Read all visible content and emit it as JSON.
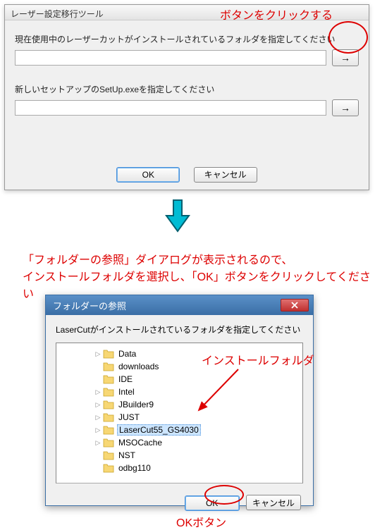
{
  "dialog1": {
    "title": "レーザー設定移行ツール",
    "label1": "現在使用中のレーザーカットがインストールされているフォルダを指定してください",
    "label2": "新しいセットアップのSetUp.exeを指定してください",
    "browse_arrow": "→",
    "ok_label": "OK",
    "cancel_label": "キャンセル"
  },
  "annotation1": "ボタンをクリックする",
  "instruction_line1": "「フォルダーの参照」ダイアログが表示されるので、",
  "instruction_line2": "インストールフォルダを選択し、「OK」ボタンをクリックしてください",
  "dialog2": {
    "title": "フォルダーの参照",
    "label": "LaserCutがインストールされているフォルダを指定してください",
    "ok_label": "OK",
    "cancel_label": "キャンセル",
    "tree": [
      {
        "name": "Data",
        "expand": true
      },
      {
        "name": "downloads",
        "expand": false
      },
      {
        "name": "IDE",
        "expand": false
      },
      {
        "name": "Intel",
        "expand": true
      },
      {
        "name": "JBuilder9",
        "expand": true
      },
      {
        "name": "JUST",
        "expand": true
      },
      {
        "name": "LaserCut55_GS4030",
        "expand": true,
        "selected": true
      },
      {
        "name": "MSOCache",
        "expand": true
      },
      {
        "name": "NST",
        "expand": false
      },
      {
        "name": "odbg110",
        "expand": false
      }
    ]
  },
  "install_folder_anno": "インストールフォルダ",
  "ok_button_anno": "OKボタン"
}
